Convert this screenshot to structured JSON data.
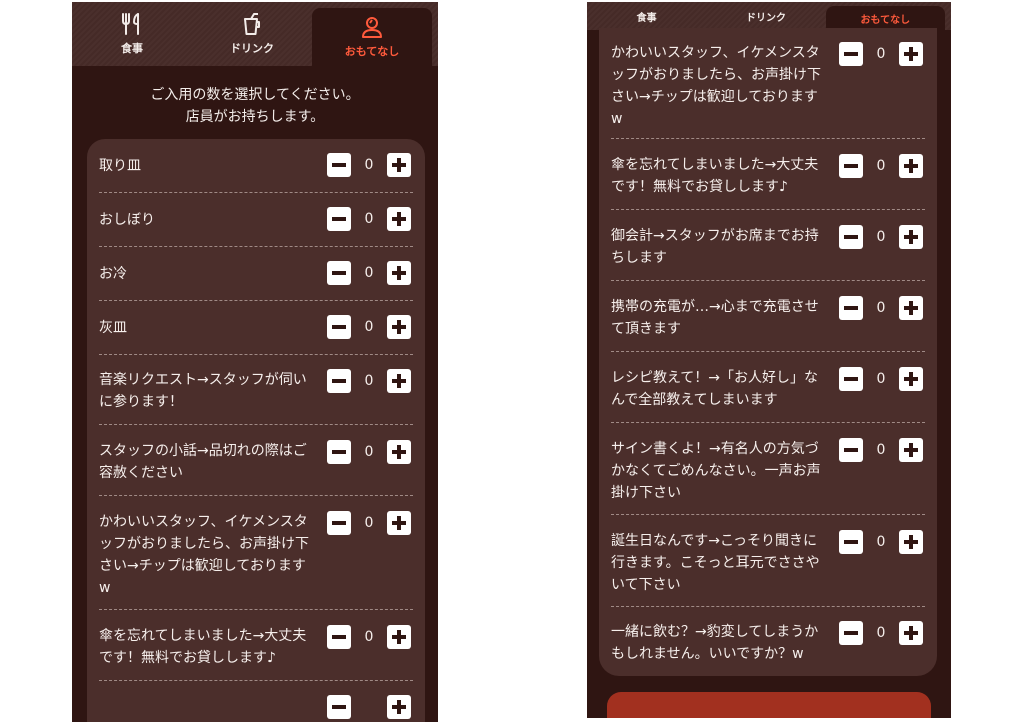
{
  "tabs": [
    {
      "label": "食事",
      "icon": "fork-knife-icon"
    },
    {
      "label": "ドリンク",
      "icon": "drink-cup-icon"
    },
    {
      "label": "おもてなし",
      "icon": "staff-person-icon",
      "active": true
    }
  ],
  "instruction": {
    "line1": "ご入用の数を選択してください。",
    "line2": "店員がお持ちします。"
  },
  "screen_left": {
    "items": [
      {
        "label": "取り皿",
        "qty": "0"
      },
      {
        "label": "おしぼり",
        "qty": "0"
      },
      {
        "label": "お冷",
        "qty": "0"
      },
      {
        "label": "灰皿",
        "qty": "0"
      },
      {
        "label": "音楽リクエスト→スタッフが伺いに参ります！",
        "qty": "0"
      },
      {
        "label": "スタッフの小話→品切れの際はご容赦ください",
        "qty": "0"
      },
      {
        "label": "かわいいスタッフ、イケメンスタッフがおりましたら、お声掛け下さい→チップは歓迎しておりますw",
        "qty": "0"
      },
      {
        "label": "傘を忘れてしまいました→大丈夫です！無料でお貸しします♪",
        "qty": "0"
      }
    ]
  },
  "screen_right": {
    "items": [
      {
        "label": "かわいいスタッフ、イケメンスタッフがおりましたら、お声掛け下さい→チップは歓迎しておりますw",
        "qty": "0"
      },
      {
        "label": "傘を忘れてしまいました→大丈夫です！無料でお貸しします♪",
        "qty": "0"
      },
      {
        "label": "御会計→スタッフがお席までお持ちします",
        "qty": "0"
      },
      {
        "label": "携帯の充電が…→心まで充電させて頂きます",
        "qty": "0"
      },
      {
        "label": "レシピ教えて！→「お人好し」なんで全部教えてしまいます",
        "qty": "0"
      },
      {
        "label": "サイン書くよ！→有名人の方気づかなくてごめんなさい。一声お声掛け下さい",
        "qty": "0"
      },
      {
        "label": "誕生日なんです→こっそり聞きに行きます。こそっと耳元でささやいて下さい",
        "qty": "0"
      },
      {
        "label": "一緒に飲む？→豹変してしまうかもしれません。いいですか？w",
        "qty": "0"
      }
    ]
  },
  "colors": {
    "background": "#2f1512",
    "card": "#4b2e2b",
    "accent": "#ff5a3c",
    "bottom_button": "#a2301f"
  }
}
